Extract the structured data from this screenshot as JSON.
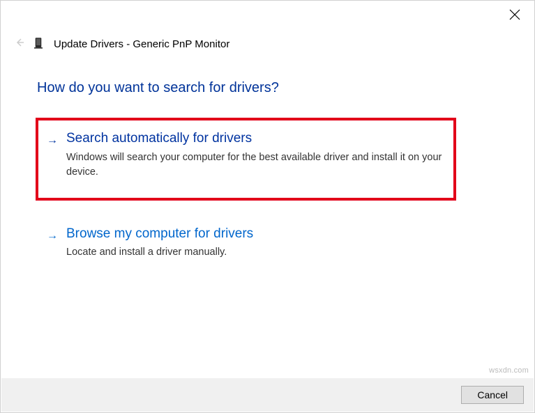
{
  "close_label": "Close",
  "header": {
    "title": "Update Drivers - Generic PnP Monitor"
  },
  "heading": "How do you want to search for drivers?",
  "options": {
    "auto": {
      "title": "Search automatically for drivers",
      "desc": "Windows will search your computer for the best available driver and install it on your device."
    },
    "browse": {
      "title": "Browse my computer for drivers",
      "desc": "Locate and install a driver manually."
    }
  },
  "footer": {
    "cancel": "Cancel"
  },
  "watermark": "wsxdn.com"
}
